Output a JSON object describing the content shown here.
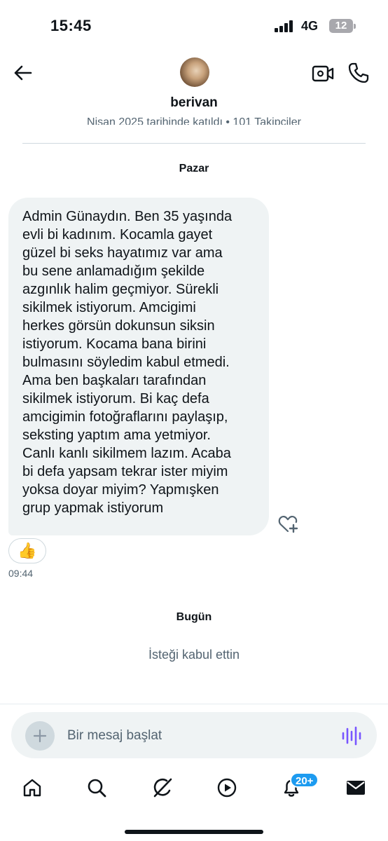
{
  "status_bar": {
    "time": "15:45",
    "network": "4G",
    "battery": "12"
  },
  "header": {
    "name": "berivan",
    "meta": "Nisan 2025 tarihinde katıldı • 101 Takipçiler"
  },
  "chat": {
    "day_label_1": "Pazar",
    "message_text": "Admin Günaydın. Ben 35 yaşında\nevli bi kadınım. Kocamla gayet\ngüzel bi seks hayatımız var ama\nbu sene anlamadığım şekilde\nazgınlık halim geçmiyor. Sürekli\nsikilmek istiyorum. Amcigimi\nherkes görsün dokunsun siksin\nistiyorum. Kocama bana birini\nbulmasını söyledim kabul etmedi.\nAma ben başkaları tarafından\nsikilmek istiyorum. Bi kaç defa\namcigimin fotoğraflarını paylaşıp,\nseksting yaptım ama yetmiyor.\nCanlı kanlı sikilmem lazım. Acaba\nbi defa yapsam tekrar ister miyim\nyoksa doyar miyim? Yapmışken\ngrup yapmak istiyorum",
    "reaction": "👍",
    "message_time": "09:44",
    "day_label_2": "Bugün",
    "system_message": "İsteği kabul ettin"
  },
  "composer": {
    "placeholder": "Bir mesaj başlat"
  },
  "tab_bar": {
    "notifications_badge": "20+"
  },
  "colors": {
    "accent": "#1d9bf0",
    "voice": "#7856ff",
    "bubble": "#eff3f4",
    "muted": "#536471"
  }
}
